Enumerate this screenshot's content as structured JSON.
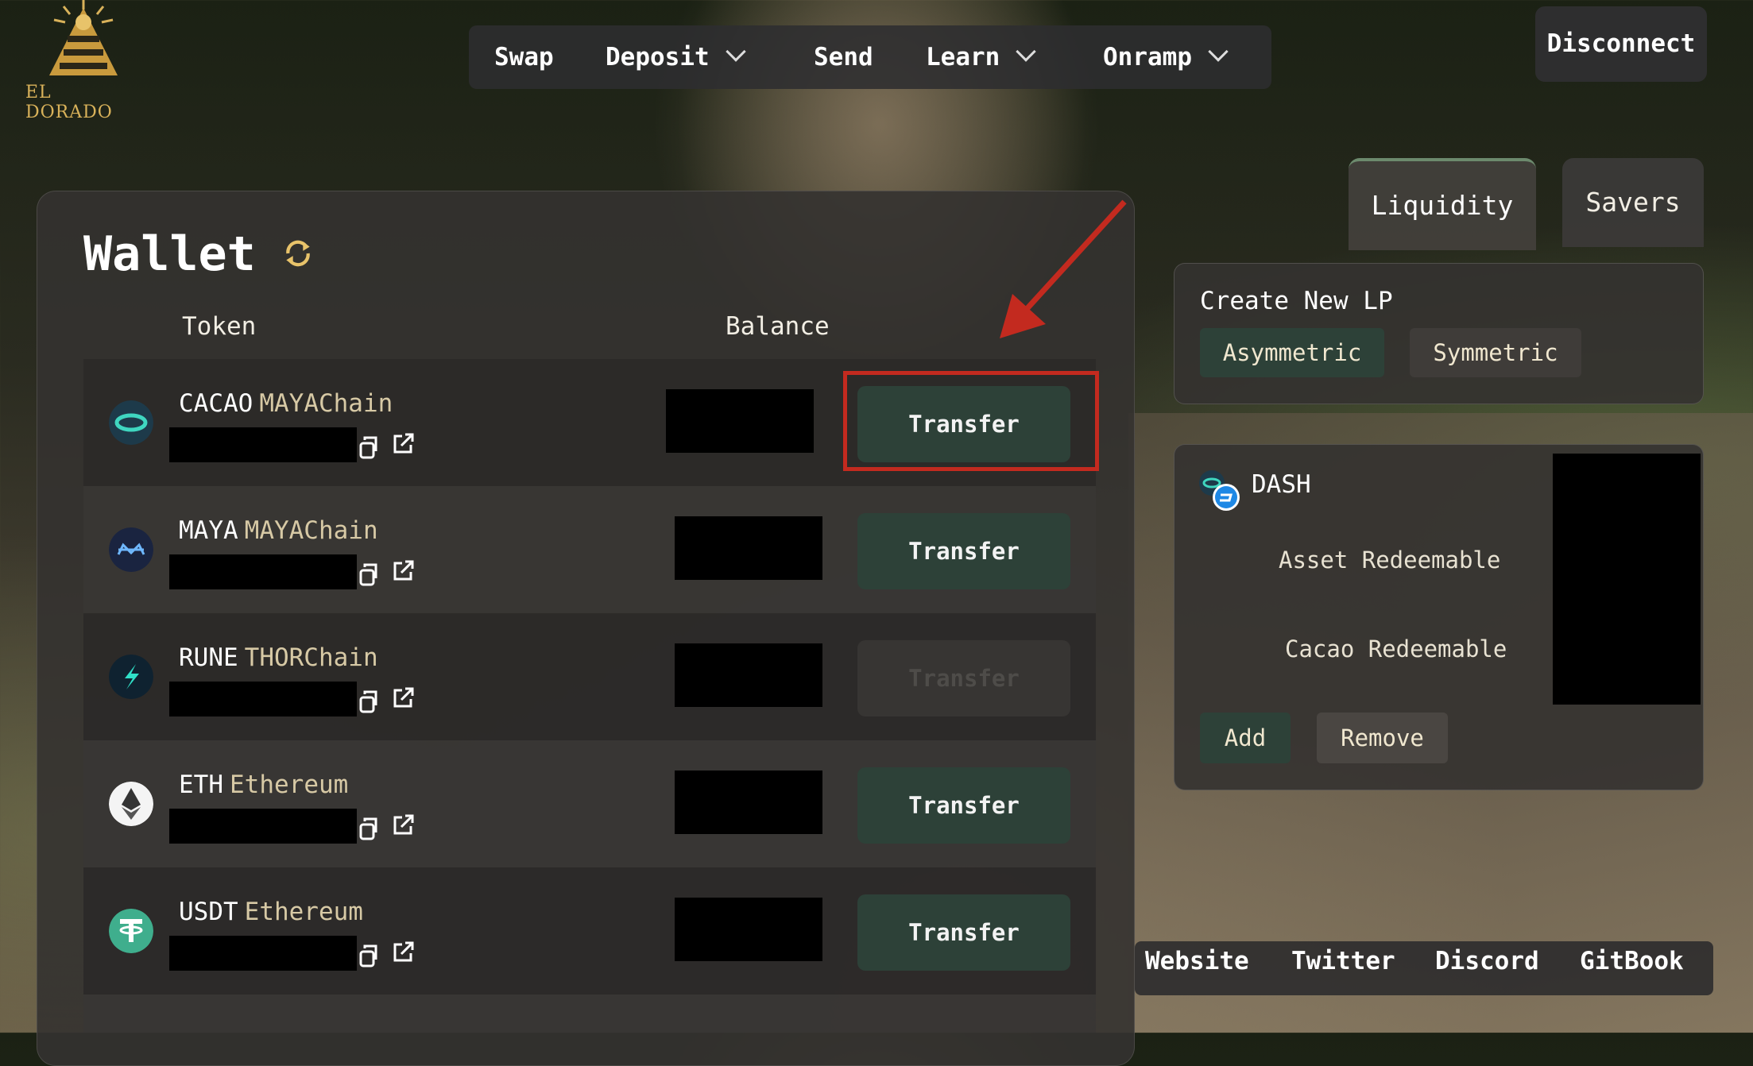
{
  "brand": {
    "logo_text": "EL DORADO"
  },
  "nav": {
    "items": [
      {
        "label": "Swap"
      },
      {
        "label": "Deposit"
      },
      {
        "label": "Send"
      },
      {
        "label": "Learn"
      },
      {
        "label": "Onramp"
      }
    ],
    "disconnect_label": "Disconnect"
  },
  "wallet": {
    "title": "Wallet",
    "columns": {
      "token": "Token",
      "balance": "Balance"
    },
    "rows": [
      {
        "symbol": "CACAO",
        "chain": "MAYAChain",
        "action": "Transfer",
        "enabled": true,
        "icon": "cacao-icon"
      },
      {
        "symbol": "MAYA",
        "chain": "MAYAChain",
        "action": "Transfer",
        "enabled": true,
        "icon": "maya-icon"
      },
      {
        "symbol": "RUNE",
        "chain": "THORChain",
        "action": "Transfer",
        "enabled": false,
        "icon": "rune-icon"
      },
      {
        "symbol": "ETH",
        "chain": "Ethereum",
        "action": "Transfer",
        "enabled": true,
        "icon": "eth-icon"
      },
      {
        "symbol": "USDT",
        "chain": "Ethereum",
        "action": "Transfer",
        "enabled": true,
        "icon": "usdt-icon"
      }
    ]
  },
  "liquidity": {
    "tabs": [
      {
        "label": "Liquidity",
        "active": true
      },
      {
        "label": "Savers",
        "active": false
      }
    ],
    "create_title": "Create New LP",
    "create_options": [
      "Asymmetric",
      "Symmetric"
    ],
    "position": {
      "asset": "DASH",
      "asset_redeemable_label": "Asset Redeemable",
      "cacao_redeemable_label": "Cacao Redeemable",
      "add_label": "Add",
      "remove_label": "Remove"
    }
  },
  "footer": {
    "links": [
      "Website",
      "Twitter",
      "Discord",
      "GitBook"
    ]
  },
  "colors": {
    "accent": "#2d4138",
    "highlight": "#c32a1f",
    "gold": "#d9b25a"
  }
}
